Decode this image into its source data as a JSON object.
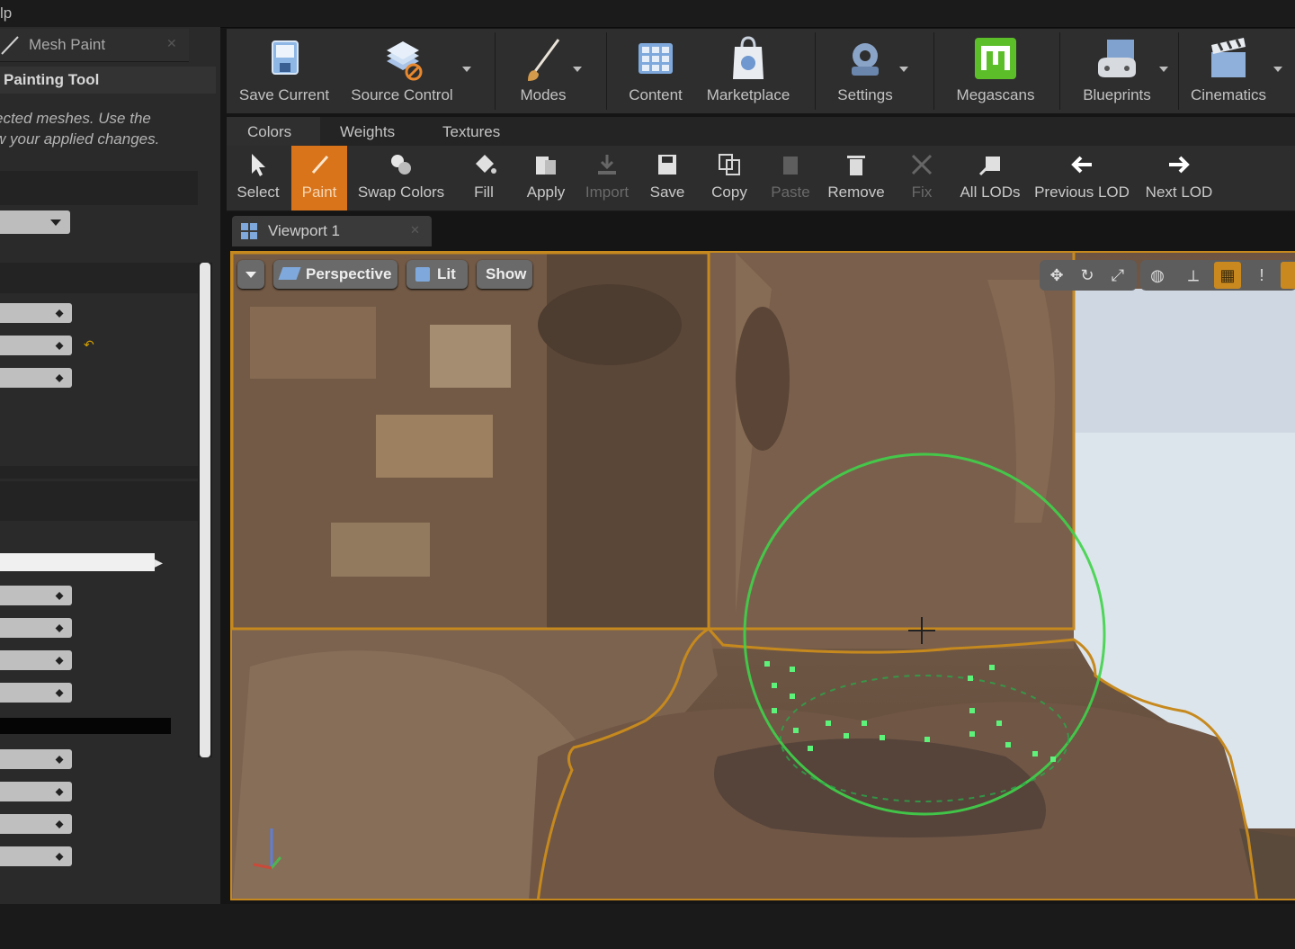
{
  "menu": {
    "partial_label": "lp"
  },
  "left_panel": {
    "tab_label": "Mesh Paint",
    "header": "Painting Tool",
    "description_line1": "ected meshes.  Use the",
    "description_line2": "w your applied changes."
  },
  "toolbar": {
    "items": [
      {
        "label": "Save Current",
        "icon": "save-icon"
      },
      {
        "label": "Source Control",
        "icon": "source-control-icon"
      },
      {
        "label": "Modes",
        "icon": "modes-brush-icon"
      },
      {
        "label": "Content",
        "icon": "content-icon"
      },
      {
        "label": "Marketplace",
        "icon": "marketplace-icon"
      },
      {
        "label": "Settings",
        "icon": "settings-icon"
      },
      {
        "label": "Megascans",
        "icon": "megascans-icon"
      },
      {
        "label": "Blueprints",
        "icon": "blueprints-icon"
      },
      {
        "label": "Cinematics",
        "icon": "cinematics-icon"
      }
    ]
  },
  "mode_tabs": [
    "Colors",
    "Weights",
    "Textures"
  ],
  "paint_toolbar": {
    "items": [
      {
        "label": "Select",
        "enabled": true
      },
      {
        "label": "Paint",
        "enabled": true,
        "active": true
      },
      {
        "label": "Swap Colors",
        "enabled": true
      },
      {
        "label": "Fill",
        "enabled": true
      },
      {
        "label": "Apply",
        "enabled": true
      },
      {
        "label": "Import",
        "enabled": false
      },
      {
        "label": "Save",
        "enabled": true
      },
      {
        "label": "Copy",
        "enabled": true
      },
      {
        "label": "Paste",
        "enabled": false
      },
      {
        "label": "Remove",
        "enabled": true
      },
      {
        "label": "Fix",
        "enabled": false
      },
      {
        "label": "All LODs",
        "enabled": true
      },
      {
        "label": "Previous LOD",
        "enabled": true
      },
      {
        "label": "Next LOD",
        "enabled": true
      }
    ]
  },
  "viewport": {
    "tab_label": "Viewport 1",
    "perspective_label": "Perspective",
    "lit_label": "Lit",
    "show_label": "Show"
  },
  "colors": {
    "accent_orange": "#d9741a",
    "selection_outline": "#c6891e",
    "brush_green": "#3fd34a",
    "megascans_green": "#5cbf2a"
  }
}
